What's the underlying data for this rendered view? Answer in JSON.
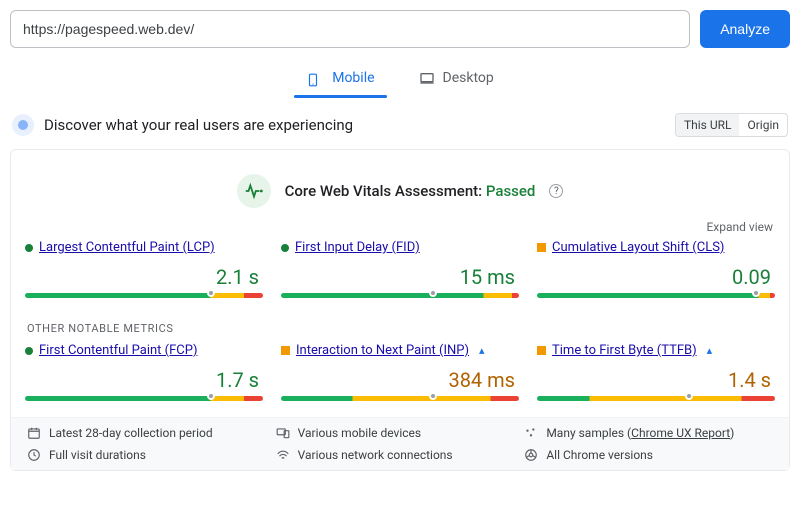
{
  "top": {
    "url": "https://pagespeed.web.dev/",
    "analyze": "Analyze"
  },
  "tabs": {
    "mobile": "Mobile",
    "desktop": "Desktop"
  },
  "header": {
    "discover": "Discover what your real users are experiencing",
    "this_url": "This URL",
    "origin": "Origin"
  },
  "assessment": {
    "prefix": "Core Web Vitals Assessment: ",
    "status": "Passed"
  },
  "expand": "Expand view",
  "metrics": {
    "lcp": {
      "name": "Largest Contentful Paint (LCP)",
      "value": "2.1 s",
      "marker": 78
    },
    "fid": {
      "name": "First Input Delay (FID)",
      "value": "15 ms",
      "marker": 64
    },
    "cls": {
      "name": "Cumulative Layout Shift (CLS)",
      "value": "0.09",
      "marker": 92
    }
  },
  "other_label": "OTHER NOTABLE METRICS",
  "other": {
    "fcp": {
      "name": "First Contentful Paint (FCP)",
      "value": "1.7 s",
      "marker": 78
    },
    "inp": {
      "name": "Interaction to Next Paint (INP)",
      "value": "384 ms",
      "marker": 64
    },
    "ttfb": {
      "name": "Time to First Byte (TTFB)",
      "value": "1.4 s",
      "marker": 64
    }
  },
  "footer": {
    "a": "Latest 28-day collection period",
    "b": "Various mobile devices",
    "c_pre": "Many samples (",
    "c_link": "Chrome UX Report",
    "c_post": ")",
    "d": "Full visit durations",
    "e": "Various network connections",
    "f": "All Chrome versions"
  }
}
